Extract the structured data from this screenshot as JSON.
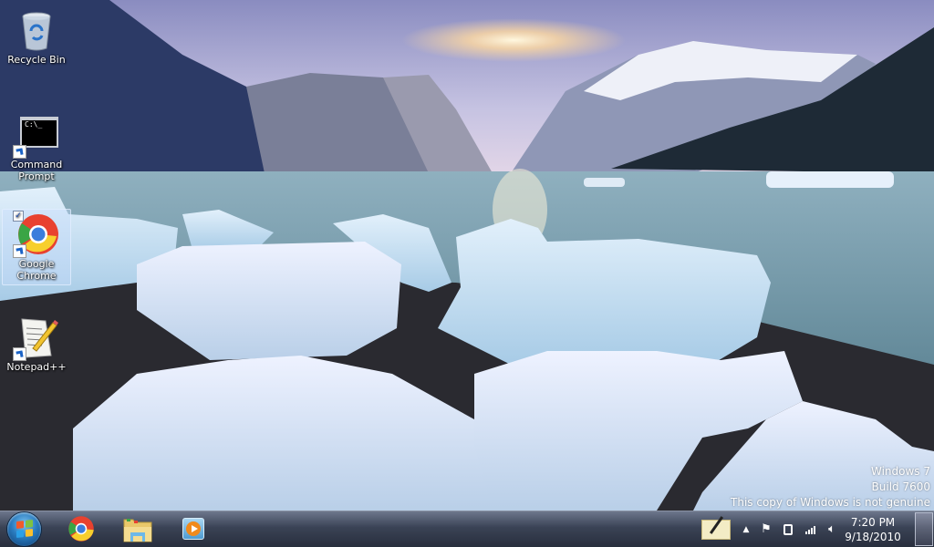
{
  "desktop": {
    "icons": [
      {
        "label": "Recycle Bin",
        "icon": "recycle-bin-icon",
        "selected": false
      },
      {
        "label": "Command Prompt",
        "icon": "command-prompt-icon",
        "selected": false,
        "shortcut": true,
        "glyph": "C:\\_"
      },
      {
        "label": "Google Chrome",
        "icon": "chrome-icon",
        "selected": true,
        "shortcut": true,
        "checked": true
      },
      {
        "label": "Notepad++",
        "icon": "notepad-plus-plus-icon",
        "selected": false,
        "shortcut": true
      }
    ],
    "watermark": {
      "line1": "Windows 7",
      "line2": "Build 7600",
      "line3": "This copy of Windows is not genuine"
    }
  },
  "taskbar": {
    "start_label": "Start",
    "pinned": [
      {
        "name": "Google Chrome",
        "icon": "chrome-icon"
      },
      {
        "name": "Windows Explorer",
        "icon": "folder-icon"
      },
      {
        "name": "Windows Media Player",
        "icon": "media-player-icon"
      }
    ],
    "tray": {
      "icons": [
        "pen-input-icon",
        "show-hidden-icons-chevron",
        "action-center-flag-icon",
        "power-plug-icon",
        "network-signal-icon",
        "volume-icon"
      ],
      "time": "7:20 PM",
      "date": "9/18/2010"
    }
  },
  "colors": {
    "taskbar_bg": "#3c4455",
    "selection": "#c8dcff",
    "text": "#ffffff"
  }
}
